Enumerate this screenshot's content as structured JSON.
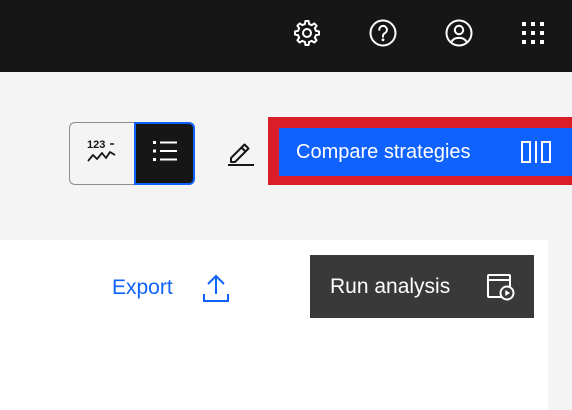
{
  "header": {
    "icons": [
      "settings-icon",
      "help-icon",
      "user-avatar-icon",
      "app-switcher-icon"
    ]
  },
  "toolbar": {
    "view_toggle": {
      "options": [
        "chart-view-icon",
        "list-view-icon"
      ],
      "selected": "list"
    },
    "edit_icon": "pencil-icon",
    "compare_button": {
      "label": "Compare strategies",
      "icon": "compare-columns-icon",
      "focused": true
    }
  },
  "actions": {
    "export_label": "Export",
    "export_icon": "upload-icon",
    "run_analysis_label": "Run analysis",
    "run_analysis_icon": "run-window-icon"
  },
  "colors": {
    "header_bg": "#161616",
    "primary": "#0f62fe",
    "focus_outline": "#da1e28",
    "secondary_button": "#393939",
    "page_bg": "#f4f4f4"
  }
}
